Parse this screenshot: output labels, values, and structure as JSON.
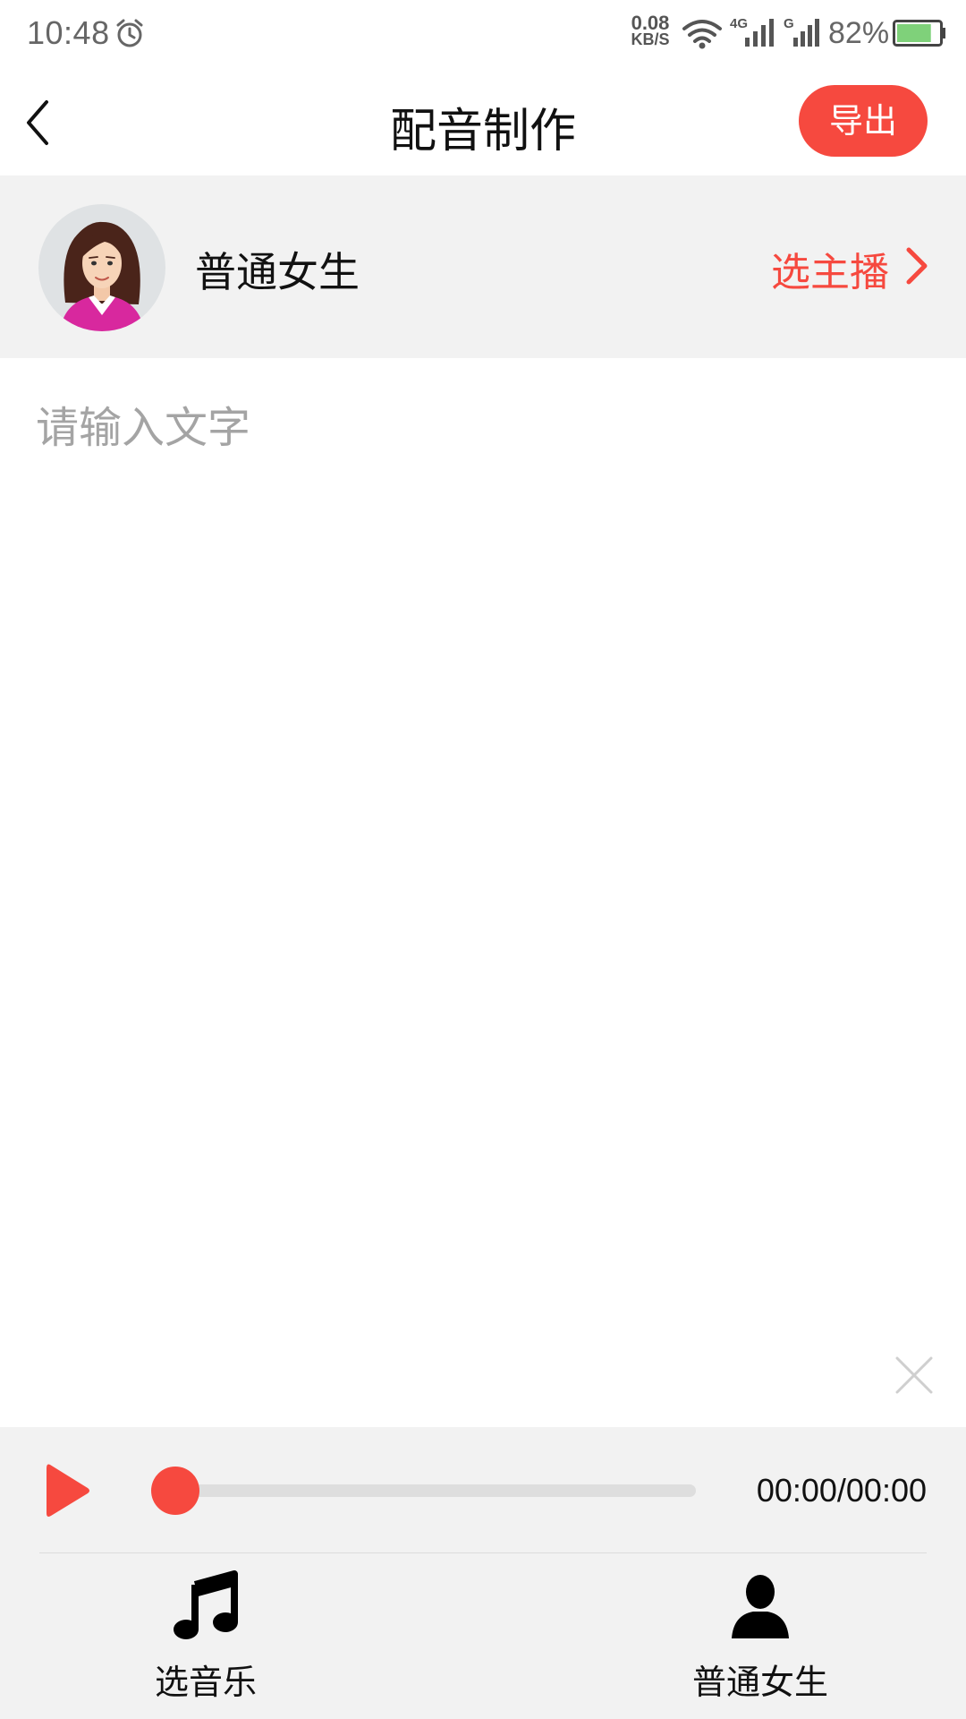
{
  "status_bar": {
    "time": "10:48",
    "net_speed_value": "0.08",
    "net_speed_unit": "KB/S",
    "signal1_label": "4G",
    "signal2_label": "G",
    "battery_percent": "82%",
    "battery_level": 0.82
  },
  "header": {
    "title": "配音制作",
    "export_label": "导出"
  },
  "anchor": {
    "name": "普通女生",
    "select_label": "选主播"
  },
  "editor": {
    "placeholder": "请输入文字",
    "value": ""
  },
  "player": {
    "time_display": "00:00/00:00",
    "progress": 0
  },
  "toolbar": {
    "music_label": "选音乐",
    "voice_label": "普通女生"
  },
  "icons": {
    "back": "chevron-left-icon",
    "select": "chevron-right-icon",
    "clear": "close-icon",
    "play": "play-icon",
    "music": "music-note-icon",
    "voice": "person-icon"
  },
  "colors": {
    "accent": "#f6493f",
    "panel_bg": "#f2f2f2",
    "placeholder": "#a4a4a4",
    "battery": "#7fd17a"
  }
}
